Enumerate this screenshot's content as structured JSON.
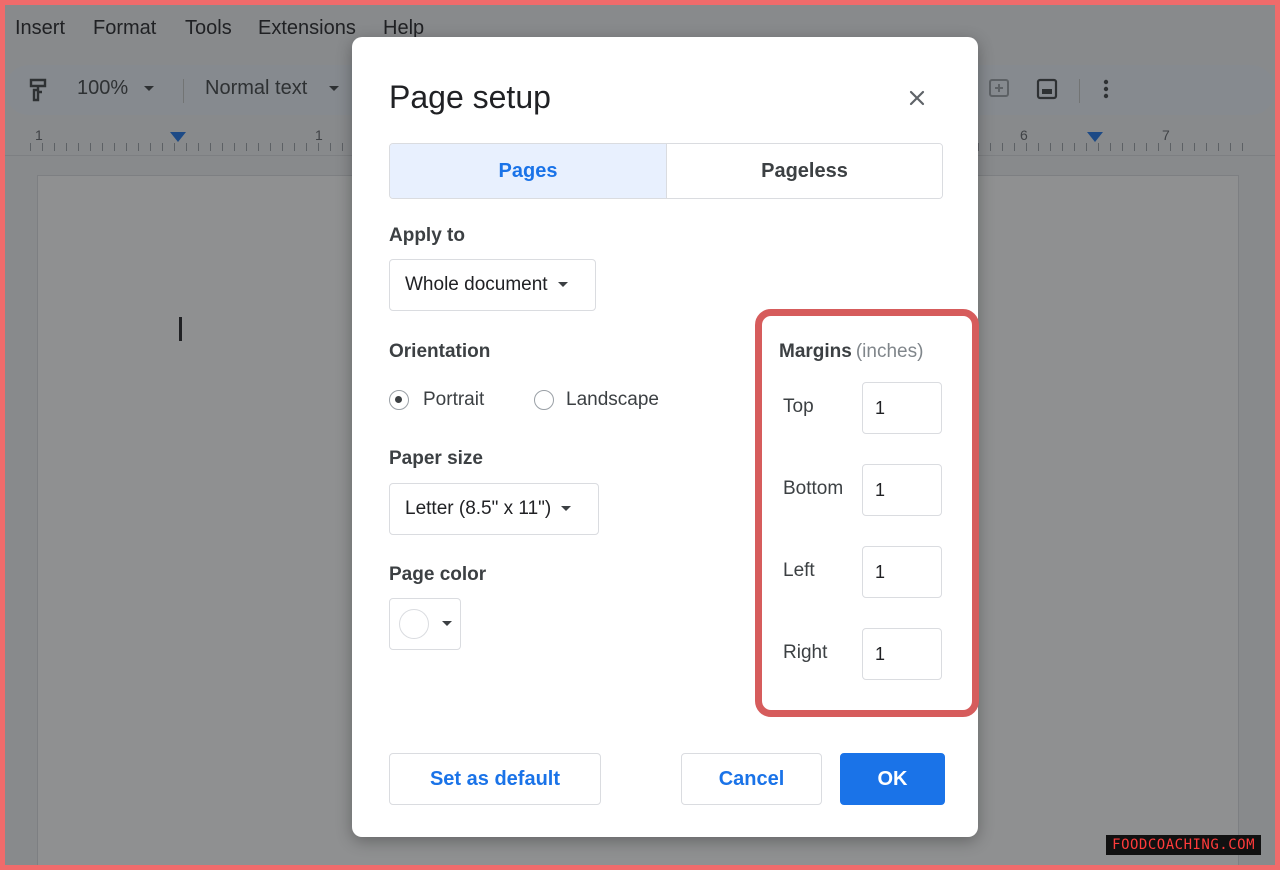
{
  "menubar": {
    "items": [
      "Insert",
      "Format",
      "Tools",
      "Extensions",
      "Help"
    ]
  },
  "toolbar": {
    "zoom": "100%",
    "style": "Normal text"
  },
  "ruler": {
    "numbers": [
      "1",
      "1",
      "6",
      "7"
    ]
  },
  "dialog": {
    "title": "Page setup",
    "tabs": [
      "Pages",
      "Pageless"
    ],
    "active_tab": "Pages",
    "apply_to": {
      "label": "Apply to",
      "value": "Whole document"
    },
    "orientation": {
      "label": "Orientation",
      "options": [
        "Portrait",
        "Landscape"
      ],
      "selected": "Portrait"
    },
    "paper_size": {
      "label": "Paper size",
      "value": "Letter (8.5\" x 11\")"
    },
    "page_color": {
      "label": "Page color",
      "value": "#ffffff"
    },
    "margins": {
      "title": "Margins",
      "unit": "(inches)",
      "top": {
        "label": "Top",
        "value": "1"
      },
      "bottom": {
        "label": "Bottom",
        "value": "1"
      },
      "left": {
        "label": "Left",
        "value": "1"
      },
      "right": {
        "label": "Right",
        "value": "1"
      }
    },
    "buttons": {
      "set_default": "Set as default",
      "cancel": "Cancel",
      "ok": "OK"
    }
  },
  "watermark": "FOODCOACHING.COM",
  "colors": {
    "accent": "#1a73e8",
    "highlight": "#d65c5c",
    "frame": "#f06b6b"
  }
}
